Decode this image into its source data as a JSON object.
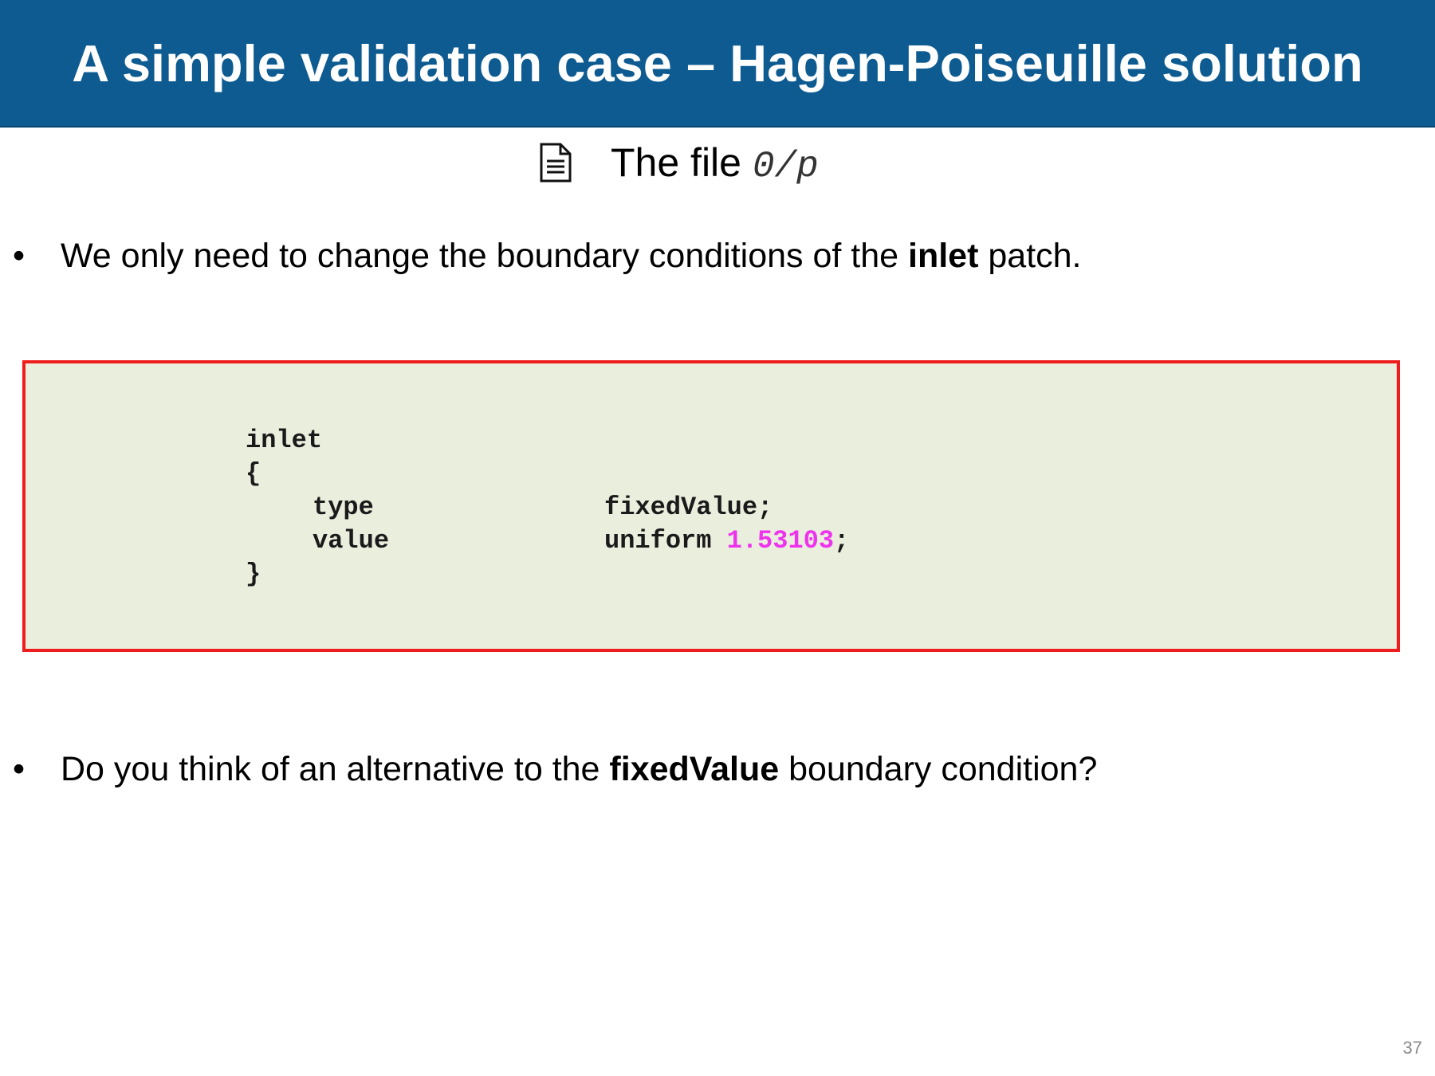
{
  "title": "A simple validation case – Hagen-Poiseuille solution",
  "file_heading": {
    "icon": "document-icon",
    "label": "The file",
    "path": "0/p"
  },
  "bullets": [
    {
      "before": "We only need to change the boundary conditions of the ",
      "bold": "inlet",
      "after": " patch."
    },
    {
      "before": "Do you think of an alternative to the ",
      "bold": "fixedValue",
      "after": " boundary condition?"
    }
  ],
  "code": {
    "patch_name": "inlet",
    "open_brace": "{",
    "type_key": "type",
    "type_value": "fixedValue;",
    "value_key": "value",
    "value_prefix": "uniform ",
    "value_number": "1.53103",
    "value_suffix": ";",
    "close_brace": "}"
  },
  "page_number": "37",
  "colors": {
    "title_bar": "#0d5b91",
    "code_background": "#eaeedd",
    "code_border": "#ee1c1c",
    "number_highlight": "#ee33ee"
  }
}
